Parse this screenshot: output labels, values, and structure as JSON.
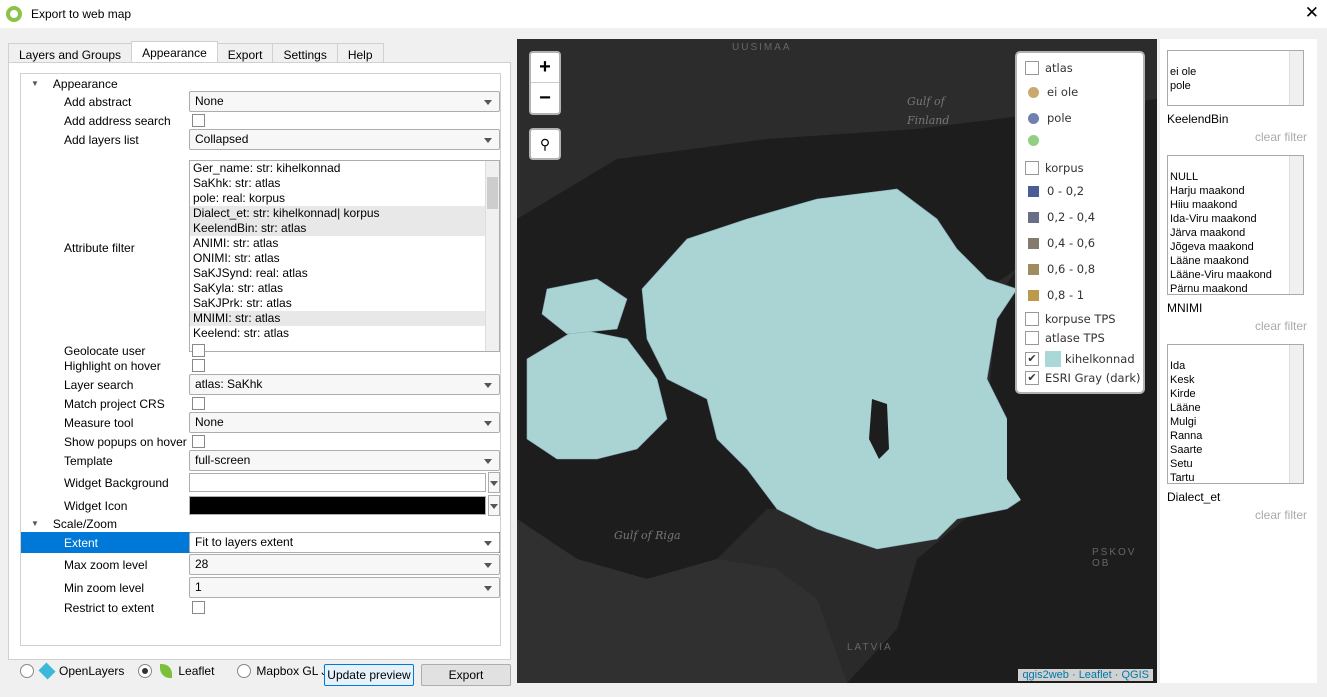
{
  "window": {
    "title": "Export to web map",
    "close": "✕"
  },
  "tabs": [
    "Layers and Groups",
    "Appearance",
    "Export",
    "Settings",
    "Help"
  ],
  "tree": {
    "group1": "Appearance",
    "add_abstract": {
      "label": "Add abstract",
      "value": "None"
    },
    "add_address_search": {
      "label": "Add address search",
      "checked": false
    },
    "add_layers_list": {
      "label": "Add layers list",
      "value": "Collapsed"
    },
    "attribute_filter": {
      "label": "Attribute filter",
      "items": [
        {
          "text": "Ger_name: str: kihelkonnad",
          "selected": false
        },
        {
          "text": "SaKhk: str: atlas",
          "selected": false
        },
        {
          "text": "pole: real: korpus",
          "selected": false
        },
        {
          "text": "Dialect_et: str: kihelkonnad| korpus",
          "selected": true
        },
        {
          "text": "KeelendBin: str: atlas",
          "selected": true
        },
        {
          "text": "ANIMI: str: atlas",
          "selected": false
        },
        {
          "text": "ONIMI: str: atlas",
          "selected": false
        },
        {
          "text": "SaKJSynd: real: atlas",
          "selected": false
        },
        {
          "text": "SaKyla: str: atlas",
          "selected": false
        },
        {
          "text": "SaKJPrk: str: atlas",
          "selected": false
        },
        {
          "text": "MNIMI: str: atlas",
          "selected": true
        },
        {
          "text": "Keelend: str: atlas",
          "selected": false
        }
      ]
    },
    "geolocate_user": "Geolocate user",
    "highlight_on_hover": "Highlight on hover",
    "layer_search": {
      "label": "Layer search",
      "value": "atlas: SaKhk"
    },
    "match_project_crs": "Match project CRS",
    "measure_tool": {
      "label": "Measure tool",
      "value": "None"
    },
    "show_popups_on_hover": "Show popups on hover",
    "template": {
      "label": "Template",
      "value": "full-screen"
    },
    "widget_background": {
      "label": "Widget Background",
      "color": "#ffffff"
    },
    "widget_icon": {
      "label": "Widget Icon",
      "color": "#000000"
    },
    "group2": "Scale/Zoom",
    "extent": {
      "label": "Extent",
      "value": "Fit to layers extent"
    },
    "max_zoom": {
      "label": "Max zoom level",
      "value": "28"
    },
    "min_zoom": {
      "label": "Min zoom level",
      "value": "1"
    },
    "restrict_to_extent": "Restrict to extent"
  },
  "bottom": {
    "openlayers": "OpenLayers",
    "leaflet": "Leaflet",
    "mapbox": "Mapbox GL JS",
    "selected": "Leaflet",
    "update_preview": "Update preview",
    "export": "Export"
  },
  "map": {
    "zoom_in": "+",
    "zoom_out": "−",
    "search_icon": "binoculars",
    "labels": {
      "uusimaa": "UUSIMAA",
      "gulf_finland_1": "Gulf of",
      "gulf_finland_2": "Finland",
      "gulf_riga": "Gulf of Riga",
      "latvia": "LATVIA",
      "pskov": "PSKOV OB"
    },
    "legend": [
      {
        "type": "checkbox",
        "label": "atlas",
        "checked": false
      },
      {
        "type": "dot",
        "label": "ei ole",
        "color": "#c8aa6e"
      },
      {
        "type": "dot",
        "label": "pole",
        "color": "#7080b0"
      },
      {
        "type": "dot",
        "label": "",
        "color": "#90d080"
      },
      {
        "type": "checkbox",
        "label": "korpus",
        "checked": false
      },
      {
        "type": "square",
        "label": "0 - 0,2",
        "color": "#4a5d94"
      },
      {
        "type": "square",
        "label": "0,2 - 0,4",
        "color": "#6a6f86"
      },
      {
        "type": "square",
        "label": "0,4 - 0,6",
        "color": "#847a70"
      },
      {
        "type": "square",
        "label": "0,6 - 0,8",
        "color": "#a08c60"
      },
      {
        "type": "square",
        "label": "0,8 - 1",
        "color": "#bb9a4e"
      },
      {
        "type": "checkbox",
        "label": "korpuse TPS",
        "checked": false
      },
      {
        "type": "checkbox",
        "label": "atlase TPS",
        "checked": false
      },
      {
        "type": "checkbox-swatch",
        "label": "kihelkonnad",
        "checked": true,
        "color": "#a8d8d8"
      },
      {
        "type": "checkbox",
        "label": "ESRI Gray (dark)",
        "checked": true
      }
    ],
    "attribution": "qgis2web · Leaflet · QGIS",
    "land_color": "#aad3d3"
  },
  "filters": [
    {
      "name": "KeelendBin",
      "items": [
        "",
        "ei ole",
        "pole"
      ],
      "clear": "clear filter"
    },
    {
      "name": "MNIMI",
      "items": [
        "",
        "NULL",
        "Harju maakond",
        "Hiiu maakond",
        "Ida-Viru maakond",
        "Järva maakond",
        "Jõgeva maakond",
        "Lääne maakond",
        "Lääne-Viru maakond",
        "Pärnu maakond"
      ],
      "clear": "clear filter"
    },
    {
      "name": "Dialect_et",
      "items": [
        "",
        "Ida",
        "Kesk",
        "Kirde",
        "Lääne",
        "Mulgi",
        "Ranna",
        "Saarte",
        "Setu",
        "Tartu"
      ],
      "clear": "clear filter"
    }
  ]
}
